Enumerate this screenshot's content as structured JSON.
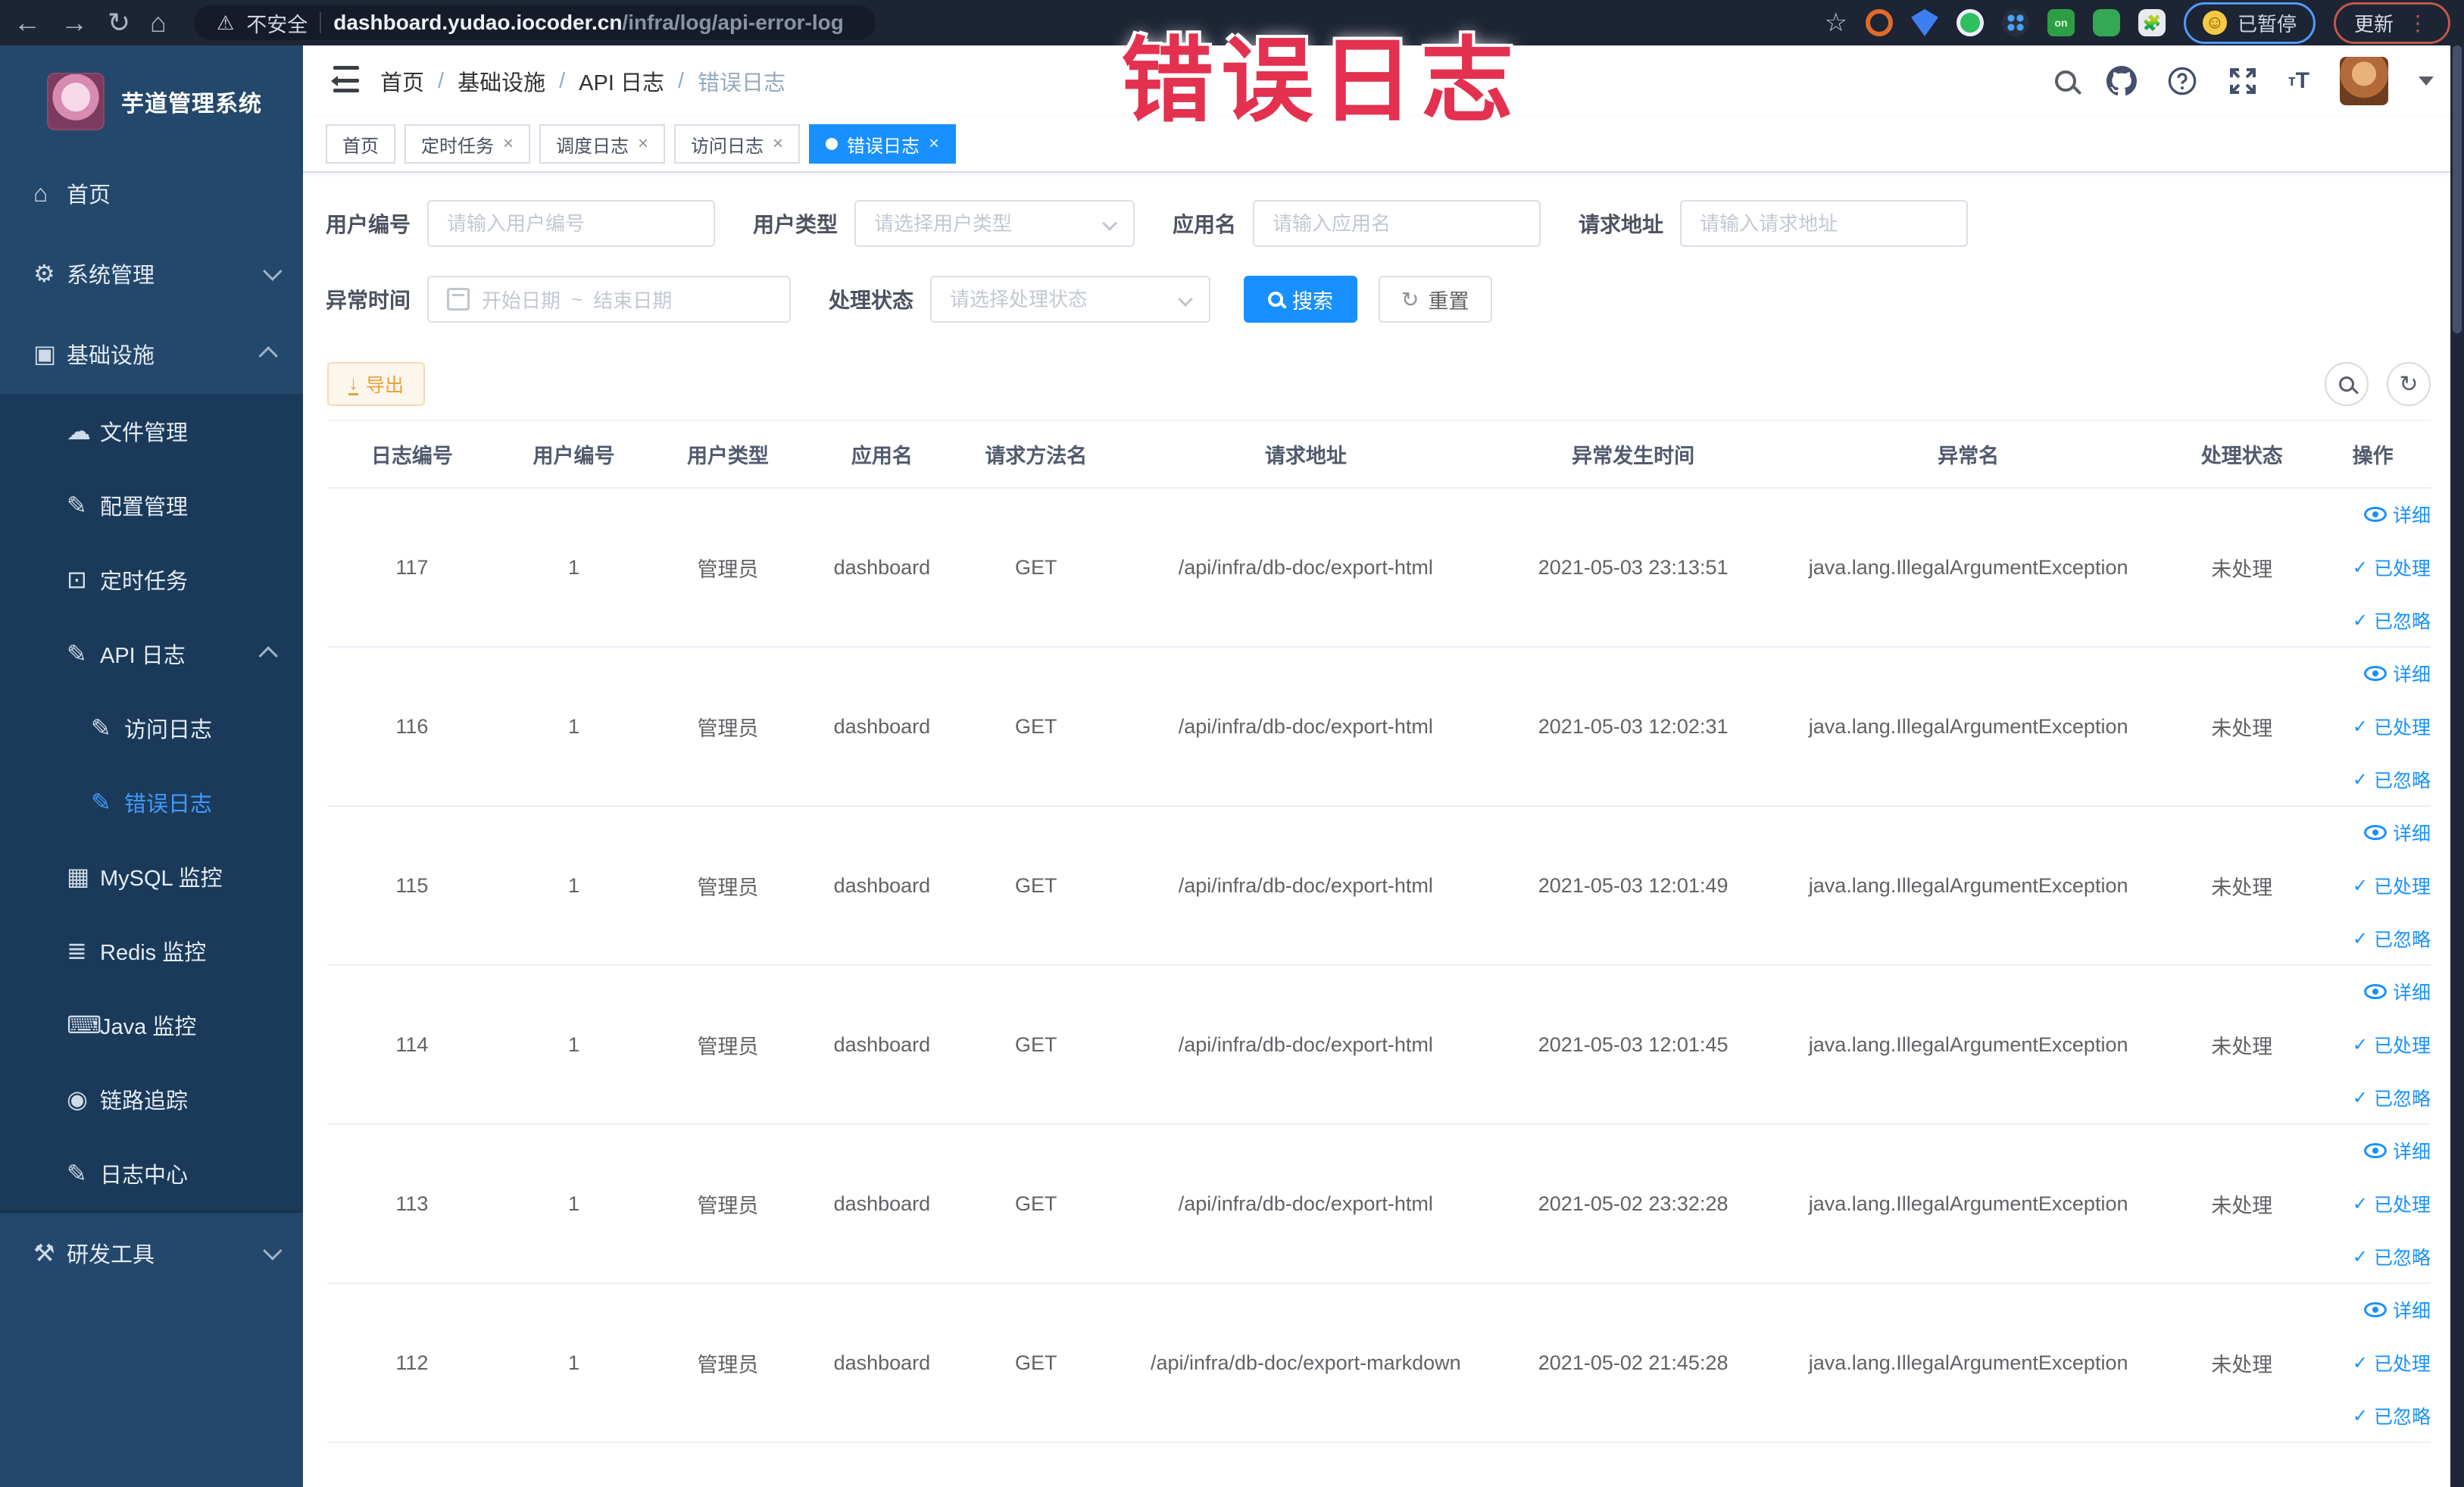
{
  "annotation": {
    "text": "错误日志",
    "color": "#e3314f"
  },
  "browser": {
    "security_label": "不安全",
    "url_host": "dashboard.yudao.iocoder.cn",
    "url_path": "/infra/log/api-error-log",
    "paused_label": "已暂停",
    "update_label": "更新"
  },
  "icons": {
    "back": "←",
    "forward": "→",
    "reload": "↻",
    "home": "⌂",
    "star": "☆",
    "warning": "⚠",
    "smiley": "☺",
    "kebab": "⋮",
    "close": "×",
    "dot": "•",
    "slash": "/",
    "download": "↓",
    "check": "✓",
    "refresh": "↻",
    "ext_on": "on"
  },
  "sidebar": {
    "title": "芋道管理系统",
    "items": [
      {
        "label": "首页",
        "icon": "home-icon",
        "glyph": "⌂"
      },
      {
        "label": "系统管理",
        "icon": "gear-icon",
        "glyph": "⚙",
        "chevron": "down"
      },
      {
        "label": "基础设施",
        "icon": "monitor-icon",
        "glyph": "▣",
        "chevron": "up"
      },
      {
        "label": "文件管理",
        "icon": "cloud-upload-icon",
        "glyph": "☁"
      },
      {
        "label": "配置管理",
        "icon": "edit-icon",
        "glyph": "✎"
      },
      {
        "label": "定时任务",
        "icon": "schedule-icon",
        "glyph": "⊡"
      },
      {
        "label": "API 日志",
        "icon": "edit-icon",
        "glyph": "✎",
        "chevron": "up"
      },
      {
        "label": "访问日志",
        "icon": "edit-icon",
        "glyph": "✎"
      },
      {
        "label": "错误日志",
        "icon": "edit-icon",
        "glyph": "✎",
        "active": true
      },
      {
        "label": "MySQL 监控",
        "icon": "chart-icon",
        "glyph": "▦"
      },
      {
        "label": "Redis 监控",
        "icon": "database-icon",
        "glyph": "≣"
      },
      {
        "label": "Java 监控",
        "icon": "java-monitor-icon",
        "glyph": "⌨"
      },
      {
        "label": "链路追踪",
        "icon": "eye-icon",
        "glyph": "◉"
      },
      {
        "label": "日志中心",
        "icon": "log-edit-icon",
        "glyph": "✎"
      },
      {
        "label": "研发工具",
        "icon": "tools-icon",
        "glyph": "⚒",
        "chevron": "down"
      }
    ]
  },
  "header": {
    "breadcrumb": [
      "首页",
      "基础设施",
      "API 日志",
      "错误日志"
    ]
  },
  "tabs": [
    {
      "label": "首页",
      "closable": false,
      "active": false
    },
    {
      "label": "定时任务",
      "closable": true,
      "active": false
    },
    {
      "label": "调度日志",
      "closable": true,
      "active": false
    },
    {
      "label": "访问日志",
      "closable": true,
      "active": false
    },
    {
      "label": "错误日志",
      "closable": true,
      "active": true
    }
  ],
  "filters": {
    "user_id_label": "用户编号",
    "user_id_placeholder": "请输入用户编号",
    "user_type_label": "用户类型",
    "user_type_placeholder": "请选择用户类型",
    "app_name_label": "应用名",
    "app_name_placeholder": "请输入应用名",
    "request_url_label": "请求地址",
    "request_url_placeholder": "请输入请求地址",
    "exception_time_label": "异常时间",
    "date_start_placeholder": "开始日期",
    "date_range_separator": "~",
    "date_end_placeholder": "结束日期",
    "process_status_label": "处理状态",
    "process_status_placeholder": "请选择处理状态",
    "search_label": "搜索",
    "reset_label": "重置"
  },
  "toolbar": {
    "export_label": "导出"
  },
  "table": {
    "columns": [
      "日志编号",
      "用户编号",
      "用户类型",
      "应用名",
      "请求方法名",
      "请求地址",
      "异常发生时间",
      "异常名",
      "处理状态",
      "操作"
    ],
    "row_actions": [
      "详细",
      "已处理",
      "已忽略"
    ],
    "rows": [
      {
        "id": "117",
        "user_id": "1",
        "user_type": "管理员",
        "app_name": "dashboard",
        "method": "GET",
        "url": "/api/infra/db-doc/export-html",
        "time": "2021-05-03 23:13:51",
        "exception": "java.lang.IllegalArgumentException",
        "status": "未处理"
      },
      {
        "id": "116",
        "user_id": "1",
        "user_type": "管理员",
        "app_name": "dashboard",
        "method": "GET",
        "url": "/api/infra/db-doc/export-html",
        "time": "2021-05-03 12:02:31",
        "exception": "java.lang.IllegalArgumentException",
        "status": "未处理"
      },
      {
        "id": "115",
        "user_id": "1",
        "user_type": "管理员",
        "app_name": "dashboard",
        "method": "GET",
        "url": "/api/infra/db-doc/export-html",
        "time": "2021-05-03 12:01:49",
        "exception": "java.lang.IllegalArgumentException",
        "status": "未处理"
      },
      {
        "id": "114",
        "user_id": "1",
        "user_type": "管理员",
        "app_name": "dashboard",
        "method": "GET",
        "url": "/api/infra/db-doc/export-html",
        "time": "2021-05-03 12:01:45",
        "exception": "java.lang.IllegalArgumentException",
        "status": "未处理"
      },
      {
        "id": "113",
        "user_id": "1",
        "user_type": "管理员",
        "app_name": "dashboard",
        "method": "GET",
        "url": "/api/infra/db-doc/export-html",
        "time": "2021-05-02 23:32:28",
        "exception": "java.lang.IllegalArgumentException",
        "status": "未处理"
      },
      {
        "id": "112",
        "user_id": "1",
        "user_type": "管理员",
        "app_name": "dashboard",
        "method": "GET",
        "url": "/api/infra/db-doc/export-markdown",
        "time": "2021-05-02 21:45:28",
        "exception": "java.lang.IllegalArgumentException",
        "status": "未处理"
      }
    ]
  },
  "colors": {
    "accent": "#1890ff",
    "warning": "#e6a23c",
    "link": "#1890ff",
    "sidebar_bg": "#24486b",
    "submenu_bg": "#1b3a59",
    "browser_bar_bg": "#1d2433",
    "annotation_red": "#e3314f"
  }
}
